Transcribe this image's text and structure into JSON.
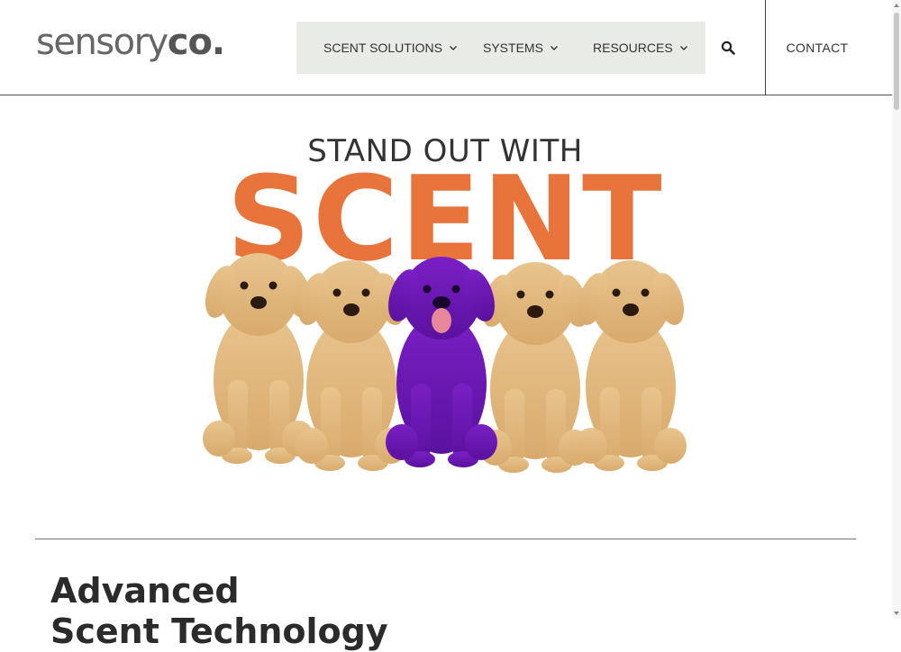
{
  "logo": {
    "brand_main": "sensory",
    "brand_suffix": "co."
  },
  "nav": {
    "items": [
      {
        "label": "SCENT SOLUTIONS"
      },
      {
        "label": "SYSTEMS"
      },
      {
        "label": "RESOURCES"
      }
    ],
    "contact_label": "CONTACT",
    "search_icon": "search-icon"
  },
  "hero": {
    "line1": "STAND OUT WITH",
    "line2": "SCENT",
    "accent_color": "#e8743b"
  },
  "section": {
    "title_line1": "Advanced",
    "title_line2": "Scent Technology"
  }
}
